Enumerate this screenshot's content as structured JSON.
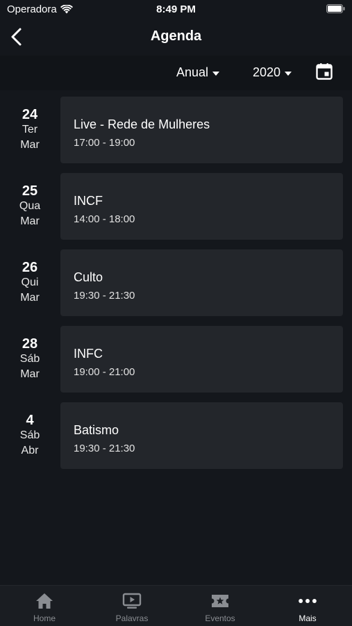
{
  "status": {
    "carrier": "Operadora",
    "time": "8:49 PM"
  },
  "header": {
    "title": "Agenda"
  },
  "filters": {
    "period": "Anual",
    "year": "2020"
  },
  "events": [
    {
      "day": "24",
      "weekday": "Ter",
      "month": "Mar",
      "title": "Live - Rede de Mulheres",
      "time": "17:00 - 19:00"
    },
    {
      "day": "25",
      "weekday": "Qua",
      "month": "Mar",
      "title": "INCF",
      "time": "14:00 - 18:00"
    },
    {
      "day": "26",
      "weekday": "Qui",
      "month": "Mar",
      "title": "Culto",
      "time": "19:30 - 21:30"
    },
    {
      "day": "28",
      "weekday": "Sáb",
      "month": "Mar",
      "title": "INFC",
      "time": "19:00 - 21:00"
    },
    {
      "day": "4",
      "weekday": "Sáb",
      "month": "Abr",
      "title": "Batismo",
      "time": "19:30 - 21:30"
    }
  ],
  "tabs": [
    {
      "label": "Home",
      "icon": "home-icon"
    },
    {
      "label": "Palavras",
      "icon": "video-icon"
    },
    {
      "label": "Eventos",
      "icon": "ticket-icon"
    },
    {
      "label": "Mais",
      "icon": "more-icon"
    }
  ],
  "colors": {
    "background": "#14171c",
    "card": "#23262b",
    "tab_inactive": "#8a8d92",
    "tab_active": "#ffffff"
  }
}
